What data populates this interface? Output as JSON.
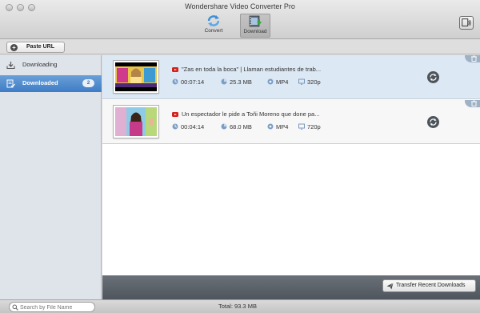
{
  "window": {
    "title": "Wondershare Video Converter Pro"
  },
  "toolbar": {
    "convert_label": "Convert",
    "download_label": "Download",
    "convert_icon": "convert-arrows-icon",
    "download_icon": "download-film-icon",
    "device_icon": "device-icon"
  },
  "urlbar": {
    "paste_url_label": "Paste URL",
    "paste_icon": "plus-circle-icon"
  },
  "sidebar": {
    "items": [
      {
        "label": "Downloading",
        "icon": "download-tray-icon",
        "selected": false
      },
      {
        "label": "Downloaded",
        "icon": "downloaded-list-icon",
        "selected": true,
        "badge": "2"
      }
    ]
  },
  "downloads": [
    {
      "title": "\"Zas en toda la boca\" | Llaman estudiantes de trab...",
      "duration": "00:07:14",
      "size": "25.3 MB",
      "format": "MP4",
      "resolution": "320p",
      "source_icon": "youtube-icon",
      "selected": true
    },
    {
      "title": "Un espectador le pide a Toñi Moreno que done pa...",
      "duration": "00:04:14",
      "size": "68.0 MB",
      "format": "MP4",
      "resolution": "720p",
      "source_icon": "youtube-icon",
      "selected": false
    }
  ],
  "footer": {
    "transfer_label": "Transfer Recent Downloads",
    "search_placeholder": "Search by File Name",
    "total": "Total: 93.3 MB"
  },
  "colors": {
    "sidebar_selected": "#4b86c9",
    "row_selected": "#dce8f4",
    "youtube_red": "#d5201b",
    "footer_strip": "#5b6168"
  }
}
